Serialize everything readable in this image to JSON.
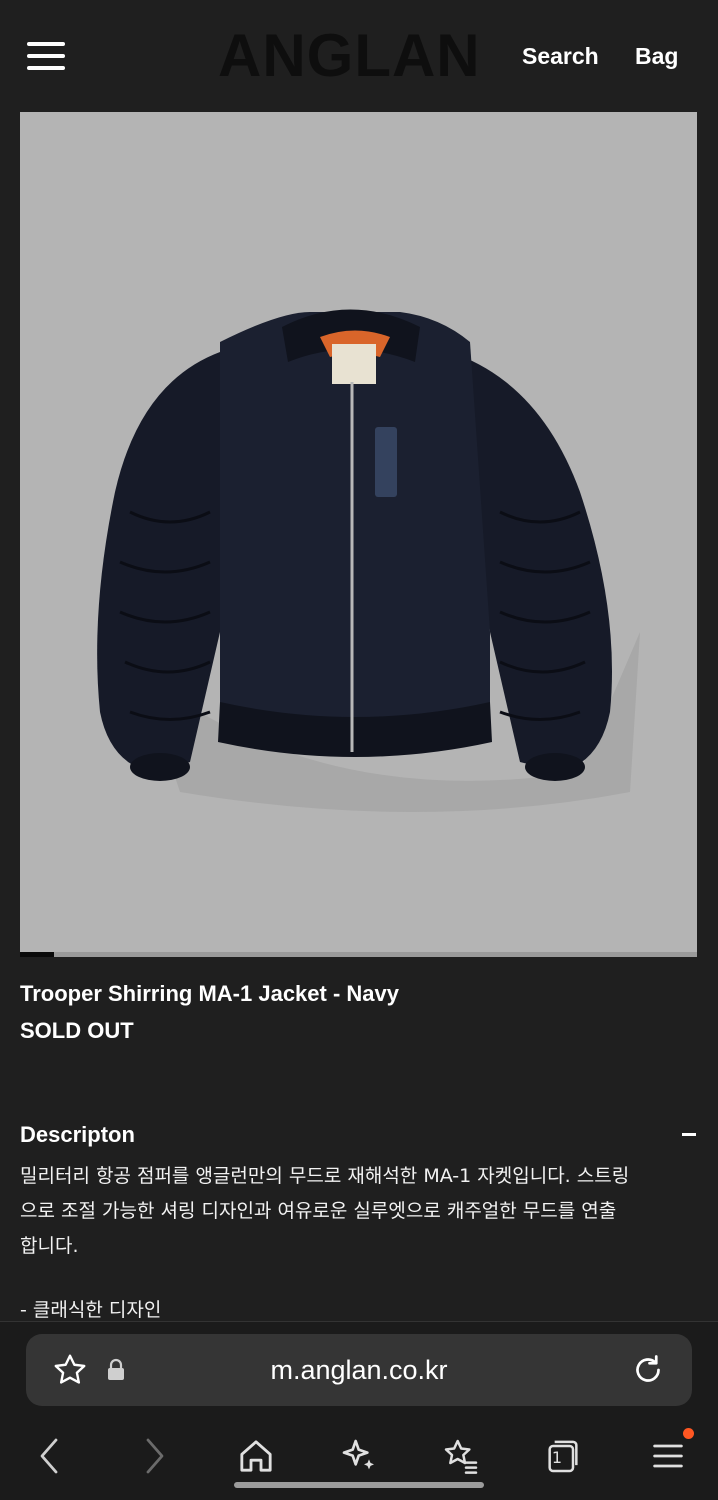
{
  "header": {
    "logo": "ANGLAN",
    "search_label": "Search",
    "bag_label": "Bag"
  },
  "product": {
    "title": "Trooper Shirring MA-1 Jacket - Navy",
    "status": "SOLD OUT",
    "image_alt_icon": "jacket-image",
    "carousel_progress": 0.05
  },
  "description": {
    "heading": "Descripton",
    "toggle_icon": "minus-icon",
    "lines": [
      "밀리터리 항공 점퍼를 앵글런만의 무드로 재해석한 MA-1 자켓입니다. 스트링",
      "으로 조절 가능한 셔링 디자인과 여유로운 실루엣으로 캐주얼한 무드를 연출",
      "합니다."
    ],
    "feature": "- 클래식한 디자인"
  },
  "browser": {
    "url": "m.anglan.co.kr",
    "icons": [
      "star-icon",
      "lock-icon",
      "reload-icon",
      "back-icon",
      "forward-icon",
      "home-icon",
      "sparkle-icon",
      "bookmarks-icon",
      "tabs-icon",
      "menu-icon"
    ],
    "tab_count": "1",
    "notification_color": "#ff5722"
  },
  "colors": {
    "background": "#1f1f1f",
    "image_background": "#b4b4b4",
    "jacket": "#161a28",
    "lining": "#d9652a"
  }
}
